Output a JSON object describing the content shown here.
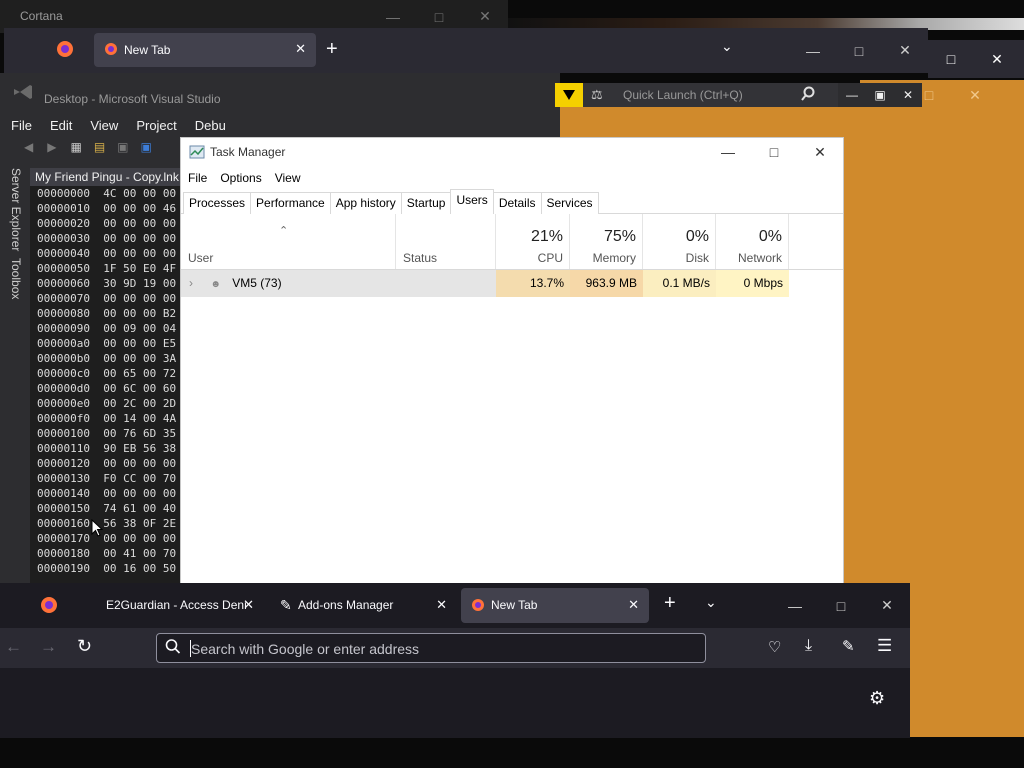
{
  "cortana": {
    "title": "Cortana"
  },
  "firefox_back": {
    "tab_label": "New Tab"
  },
  "visual_studio": {
    "title": "Desktop - Microsoft Visual Studio",
    "menu": [
      "File",
      "Edit",
      "View",
      "Project",
      "Debu"
    ],
    "quick_launch_placeholder": "Quick Launch (Ctrl+Q)",
    "side_tabs": [
      "Server Explorer",
      "Toolbox"
    ],
    "document_tab": "My Friend Pingu - Copy.lnk",
    "hex_rows": [
      {
        "addr": "00000000",
        "bytes": "4C 00 00 00"
      },
      {
        "addr": "00000010",
        "bytes": "00 00 00 46"
      },
      {
        "addr": "00000020",
        "bytes": "00 00 00 00"
      },
      {
        "addr": "00000030",
        "bytes": "00 00 00 00"
      },
      {
        "addr": "00000040",
        "bytes": "00 00 00 00"
      },
      {
        "addr": "00000050",
        "bytes": "1F 50 E0 4F"
      },
      {
        "addr": "00000060",
        "bytes": "30 9D 19 00"
      },
      {
        "addr": "00000070",
        "bytes": "00 00 00 00"
      },
      {
        "addr": "00000080",
        "bytes": "00 00 00 B2"
      },
      {
        "addr": "00000090",
        "bytes": "00 09 00 04"
      },
      {
        "addr": "000000a0",
        "bytes": "00 00 00 E5"
      },
      {
        "addr": "000000b0",
        "bytes": "00 00 00 3A"
      },
      {
        "addr": "000000c0",
        "bytes": "00 65 00 72"
      },
      {
        "addr": "000000d0",
        "bytes": "00 6C 00 60"
      },
      {
        "addr": "000000e0",
        "bytes": "00 2C 00 2D"
      },
      {
        "addr": "000000f0",
        "bytes": "00 14 00 4A"
      },
      {
        "addr": "00000100",
        "bytes": "00 76 6D 35"
      },
      {
        "addr": "00000110",
        "bytes": "90 EB 56 38"
      },
      {
        "addr": "00000120",
        "bytes": "00 00 00 00"
      },
      {
        "addr": "00000130",
        "bytes": "F0 CC 00 70"
      },
      {
        "addr": "00000140",
        "bytes": "00 00 00 00"
      },
      {
        "addr": "00000150",
        "bytes": "74 61 00 40"
      },
      {
        "addr": "00000160",
        "bytes": "56 38 0F 2E"
      },
      {
        "addr": "00000170",
        "bytes": "00 00 00 00"
      },
      {
        "addr": "00000180",
        "bytes": "00 41 00 70"
      },
      {
        "addr": "00000190",
        "bytes": "00 16 00 50"
      }
    ]
  },
  "task_manager": {
    "title": "Task Manager",
    "menu": [
      "File",
      "Options",
      "View"
    ],
    "tabs": [
      "Processes",
      "Performance",
      "App history",
      "Startup",
      "Users",
      "Details",
      "Services"
    ],
    "active_tab": "Users",
    "columns": {
      "user": "User",
      "status": "Status",
      "cpu": {
        "pct": "21%",
        "label": "CPU"
      },
      "memory": {
        "pct": "75%",
        "label": "Memory"
      },
      "disk": {
        "pct": "0%",
        "label": "Disk"
      },
      "network": {
        "pct": "0%",
        "label": "Network"
      }
    },
    "rows": [
      {
        "user": "VM5 (73)",
        "status": "",
        "cpu": "13.7%",
        "memory": "963.9 MB",
        "disk": "0.1 MB/s",
        "network": "0 Mbps"
      }
    ]
  },
  "firefox": {
    "tabs": [
      {
        "label": "E2Guardian - Access Deni"
      },
      {
        "label": "Add-ons Manager"
      },
      {
        "label": "New Tab",
        "active": true
      }
    ],
    "url_placeholder": "Search with Google or enter address"
  },
  "colors": {
    "firefox_dark": "#1c1b22",
    "firefox_toolbar": "#2b2a33",
    "orange_window": "#d08a2c",
    "vs_background": "#2d2d30",
    "tm_heat_high": "#f4dcae",
    "tm_heat_low": "#fff4c4"
  }
}
